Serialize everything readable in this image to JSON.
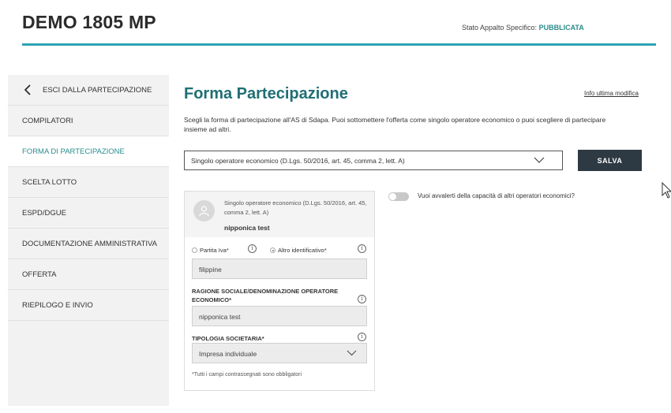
{
  "header": {
    "title": "DEMO 1805 MP",
    "status_label": "Stato Appalto Specifico:",
    "status_value": "PUBBLICATA"
  },
  "sidebar": {
    "exit_label": "ESCI DALLA PARTECIPAZIONE",
    "items": [
      {
        "label": "COMPILATORI"
      },
      {
        "label": "FORMA DI PARTECIPAZIONE",
        "active": true
      },
      {
        "label": "SCELTA LOTTO"
      },
      {
        "label": "ESPD/DGUE"
      },
      {
        "label": "DOCUMENTAZIONE AMMINISTRATIVA"
      },
      {
        "label": "OFFERTA"
      },
      {
        "label": "RIEPILOGO E INVIO"
      }
    ]
  },
  "main": {
    "title": "Forma Partecipazione",
    "info_link": "Info ultima modifica",
    "description": "Scegli la forma di partecipazione all'AS di Sdapa. Puoi sottomettere l'offerta come singolo operatore economico o puoi scegliere di partecipare insieme ad altri.",
    "participation_select": "Singolo operatore economico (D.Lgs. 50/2016, art. 45, comma 2, lett. A)",
    "save_label": "SALVA",
    "toggle_label": "Vuoi avvalerti della capacità di altri operatori economici?",
    "toggle_on": false
  },
  "card": {
    "type": "Singolo operatore economico (D.Lgs. 50/2016, art. 45, comma 2, lett. A)",
    "name": "nipponica test",
    "radio_partita_iva": "Partita Iva*",
    "radio_altro": "Altro identificativo*",
    "selected_radio": "altro",
    "identifier_value": "filippine",
    "ragione_label": "RAGIONE SOCIALE/DENOMINAZIONE OPERATORE ECONOMICO*",
    "ragione_value": "nipponica test",
    "tipologia_label": "TIPOLOGIA SOCIETARIA*",
    "tipologia_value": "Impresa individuale",
    "footnote": "*Tutti i campi contrassegnati sono obbligatori"
  },
  "colors": {
    "accent": "#2a8c8c",
    "header_line": "#2ba3b6",
    "save_button": "#2e3a43"
  }
}
